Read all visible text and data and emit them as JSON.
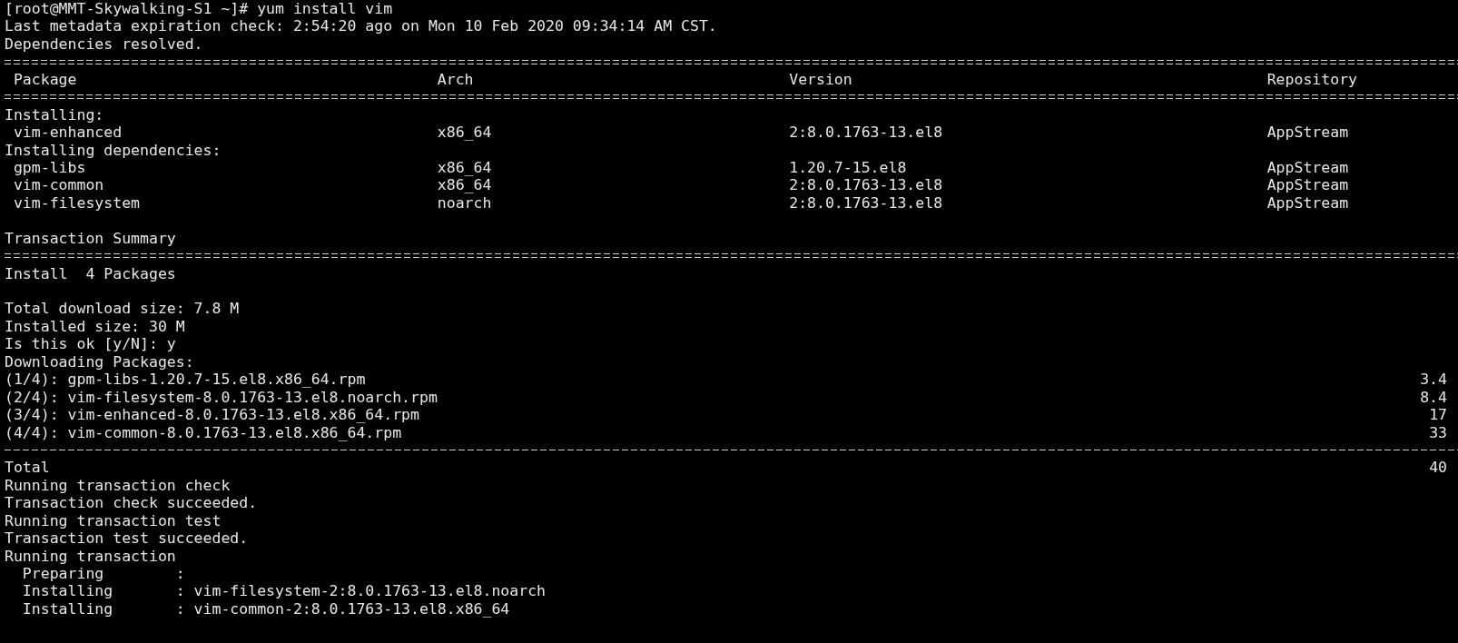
{
  "terminal": {
    "lines": [
      {
        "kind": "text",
        "text": "[root@MMT-Skywalking-S1 ~]# yum install vim"
      },
      {
        "kind": "text",
        "text": "Last metadata expiration check: 2:54:20 ago on Mon 10 Feb 2020 09:34:14 AM CST."
      },
      {
        "kind": "text",
        "text": "Dependencies resolved."
      },
      {
        "kind": "double-rule"
      },
      {
        "kind": "row",
        "cells": [
          "Package",
          "Arch",
          "Version",
          "Repository"
        ]
      },
      {
        "kind": "double-rule"
      },
      {
        "kind": "text",
        "text": "Installing:"
      },
      {
        "kind": "row",
        "cells": [
          "vim-enhanced",
          "x86_64",
          "2:8.0.1763-13.el8",
          "AppStream"
        ]
      },
      {
        "kind": "text",
        "text": "Installing dependencies:"
      },
      {
        "kind": "row",
        "cells": [
          "gpm-libs",
          "x86_64",
          "1.20.7-15.el8",
          "AppStream"
        ]
      },
      {
        "kind": "row",
        "cells": [
          "vim-common",
          "x86_64",
          "2:8.0.1763-13.el8",
          "AppStream"
        ]
      },
      {
        "kind": "row",
        "cells": [
          "vim-filesystem",
          "noarch",
          "2:8.0.1763-13.el8",
          "AppStream"
        ]
      },
      {
        "kind": "blank"
      },
      {
        "kind": "text",
        "text": "Transaction Summary"
      },
      {
        "kind": "double-rule"
      },
      {
        "kind": "text",
        "text": "Install  4 Packages"
      },
      {
        "kind": "blank"
      },
      {
        "kind": "text",
        "text": "Total download size: 7.8 M"
      },
      {
        "kind": "text",
        "text": "Installed size: 30 M"
      },
      {
        "kind": "text",
        "text": "Is this ok [y/N]: y"
      },
      {
        "kind": "text",
        "text": "Downloading Packages:"
      },
      {
        "kind": "download",
        "text": "(1/4): gpm-libs-1.20.7-15.el8.x86_64.rpm",
        "size": "3.4"
      },
      {
        "kind": "download",
        "text": "(2/4): vim-filesystem-8.0.1763-13.el8.noarch.rpm",
        "size": "8.4"
      },
      {
        "kind": "download",
        "text": "(3/4): vim-enhanced-8.0.1763-13.el8.x86_64.rpm",
        "size": "17"
      },
      {
        "kind": "download",
        "text": "(4/4): vim-common-8.0.1763-13.el8.x86_64.rpm",
        "size": "33"
      },
      {
        "kind": "dash-rule"
      },
      {
        "kind": "download",
        "text": "Total",
        "size": "40"
      },
      {
        "kind": "text",
        "text": "Running transaction check"
      },
      {
        "kind": "text",
        "text": "Transaction check succeeded."
      },
      {
        "kind": "text",
        "text": "Running transaction test"
      },
      {
        "kind": "text",
        "text": "Transaction test succeeded."
      },
      {
        "kind": "text",
        "text": "Running transaction"
      },
      {
        "kind": "text",
        "text": "  Preparing        :"
      },
      {
        "kind": "text",
        "text": "  Installing       : vim-filesystem-2:8.0.1763-13.el8.noarch"
      },
      {
        "kind": "text",
        "text": "  Installing       : vim-common-2:8.0.1763-13.el8.x86_64"
      }
    ]
  }
}
